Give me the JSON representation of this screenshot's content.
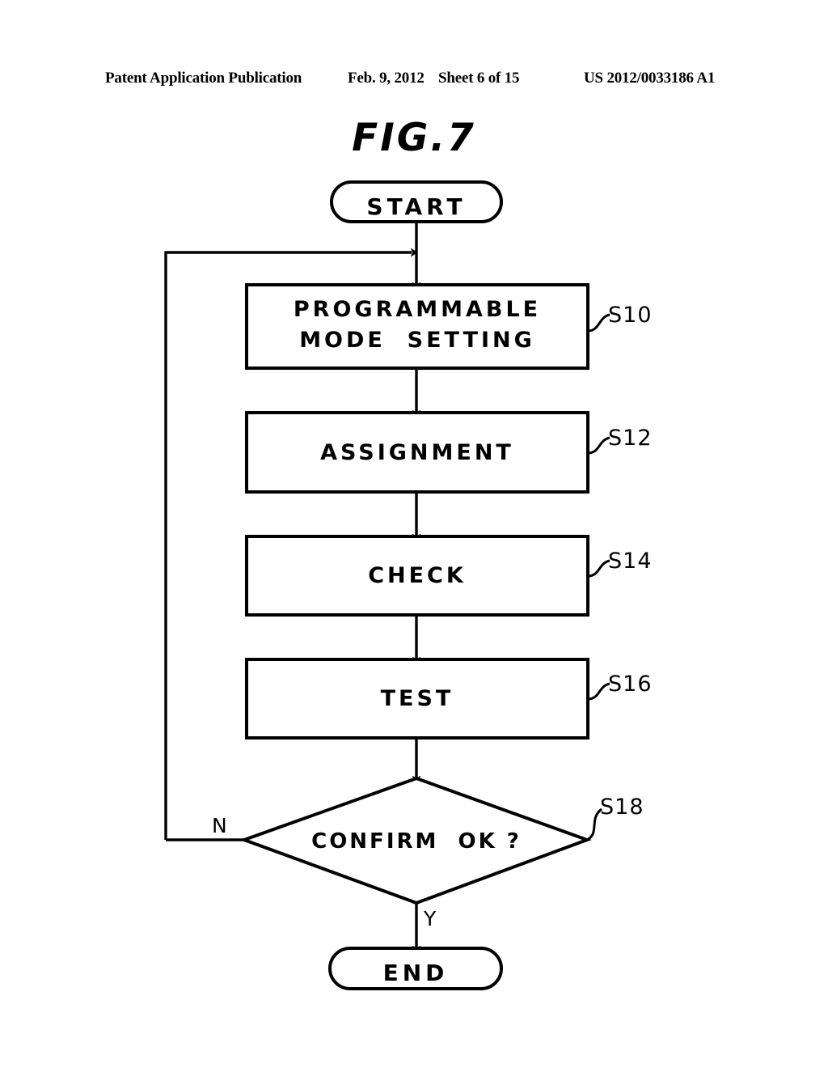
{
  "page": {
    "header": {
      "publication": "Patent Application Publication",
      "date": "Feb. 9, 2012",
      "sheet": "Sheet 6 of 15",
      "document_number": "US 2012/0033186 A1"
    },
    "figure_title": "FIG.7",
    "background_color": "#ffffff",
    "ink_color": "#000000"
  },
  "flowchart": {
    "start_node": {
      "label": "START",
      "shape": "stadium"
    },
    "end_node": {
      "label": "END",
      "shape": "stadium"
    },
    "steps": [
      {
        "label_line1": "PROGRAMMABLE",
        "label_line2": "MODE  SETTING",
        "ref": "S10",
        "shape": "rectangle"
      },
      {
        "label_line1": "ASSIGNMENT",
        "label_line2": "",
        "ref": "S12",
        "shape": "rectangle"
      },
      {
        "label_line1": "CHECK",
        "label_line2": "",
        "ref": "S14",
        "shape": "rectangle"
      },
      {
        "label_line1": "TEST",
        "label_line2": "",
        "ref": "S16",
        "shape": "rectangle"
      }
    ],
    "decision": {
      "label": "CONFIRM  OK ?",
      "ref": "S18",
      "shape": "diamond",
      "branch_no": "N",
      "branch_yes": "Y"
    }
  }
}
